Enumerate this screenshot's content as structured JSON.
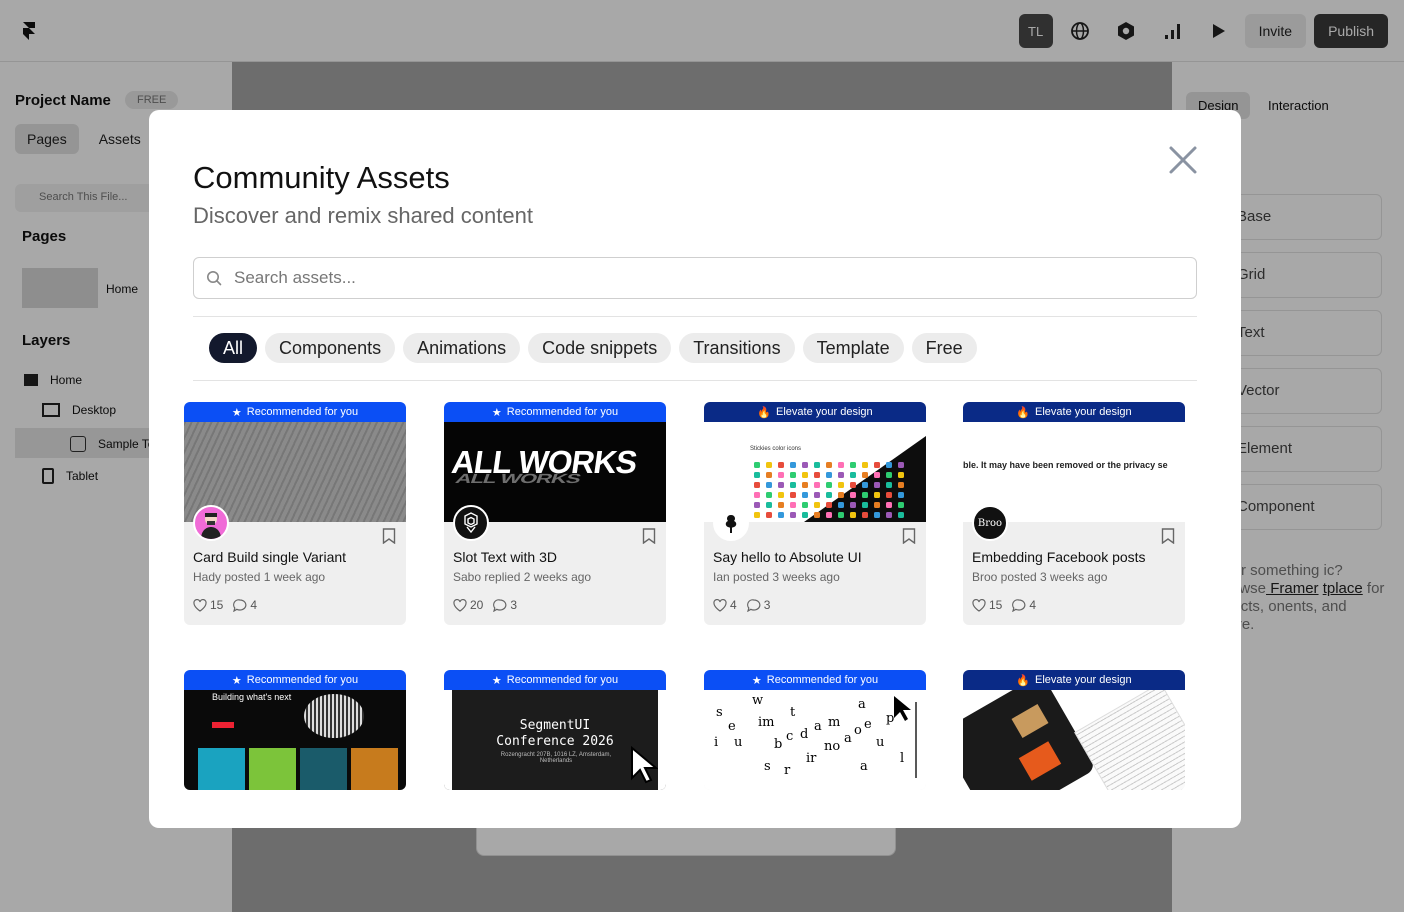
{
  "topbar": {
    "user_initials": "TL",
    "invite_label": "Invite",
    "publish_label": "Publish"
  },
  "left_panel": {
    "project_name": "Project Name",
    "plan_badge": "FREE",
    "tabs": [
      "Pages",
      "Assets"
    ],
    "search_placeholder": "Search This File...",
    "pages_heading": "Pages",
    "page_home": "Home",
    "layers_heading": "Layers",
    "layers": [
      "Home",
      "Desktop",
      "Sample Te",
      "Tablet"
    ]
  },
  "right_panel": {
    "tabs": [
      "Design",
      "Interaction"
    ],
    "items": [
      "Base",
      "Grid",
      "Text",
      "Vector",
      "Element",
      "Component"
    ],
    "note_prefix": "g for something ic? Browse",
    "note_link1": " Framer",
    "note_link2": "tplace",
    "note_suffix": " for effects, onents, and more."
  },
  "modal": {
    "title": "Community Assets",
    "subtitle": "Discover and remix shared content",
    "search_placeholder": "Search assets...",
    "chips": [
      "All",
      "Components",
      "Animations",
      "Code snippets",
      "Transitions",
      "Template",
      "Free"
    ],
    "banner_recommended": "Recommended for you",
    "banner_elevate": "Elevate your design",
    "cards": [
      {
        "title": "Card Build single Variant",
        "meta": "Hady posted 1 week ago",
        "likes": "15",
        "comments": "4"
      },
      {
        "title": "Slot Text with 3D",
        "meta": "Sabo replied 2 weeks ago",
        "likes": "20",
        "comments": "3"
      },
      {
        "title": "Say hello to Absolute UI",
        "meta": "Ian posted 3 weeks ago",
        "likes": "4",
        "comments": "3"
      },
      {
        "title": "Embedding Facebook posts",
        "meta": "Broo posted 3 weeks ago",
        "likes": "15",
        "comments": "4"
      }
    ],
    "thumb_text": {
      "all_works": "ALL WORKS",
      "fb_error": "ble. It may have been removed or the privacy se",
      "broo": "Broo",
      "building": "Building what's next",
      "segment_title": "SegmentUI",
      "segment_sub": "Conference 2026",
      "segment_addr": "Rozengracht 207B, 1016 LZ, Amsterdam, Netherlands",
      "stickies": "Stickies color icons"
    }
  }
}
